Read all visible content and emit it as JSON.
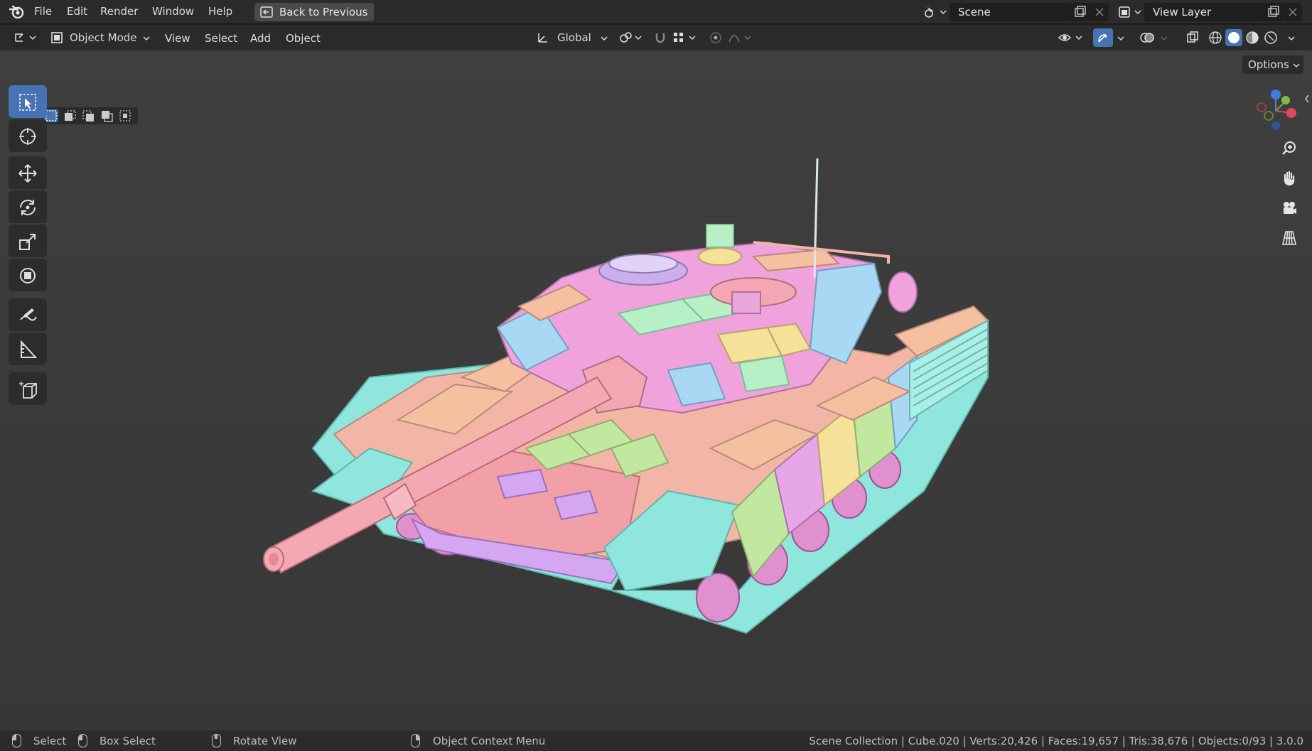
{
  "menubar": {
    "items": [
      "File",
      "Edit",
      "Render",
      "Window",
      "Help"
    ],
    "back_button": "Back to Previous",
    "scene_label": "Scene",
    "view_layer_label": "View Layer"
  },
  "header": {
    "mode": "Object Mode",
    "menus": [
      "View",
      "Select",
      "Add",
      "Object"
    ],
    "orientation": "Global",
    "options": "Options"
  },
  "toolbar": {
    "tools": [
      "select-box-icon",
      "cursor-icon",
      "move-icon",
      "rotate-icon",
      "scale-icon",
      "transform-icon",
      "annotate-icon",
      "measure-icon",
      "add-cube-icon"
    ],
    "active_index": 0
  },
  "statusbar": {
    "select": "Select",
    "box_select": "Box Select",
    "rotate_view": "Rotate View",
    "context_menu": "Object Context Menu",
    "info": "Scene Collection | Cube.020 | Verts:20,426 | Faces:19,657 | Tris:38,676 | Objects:0/93 | 3.0.0"
  },
  "colors": {
    "accent": "#4772b3",
    "viewport_bg": "#3d3d3d",
    "panel_bg": "#2b2b2b"
  }
}
